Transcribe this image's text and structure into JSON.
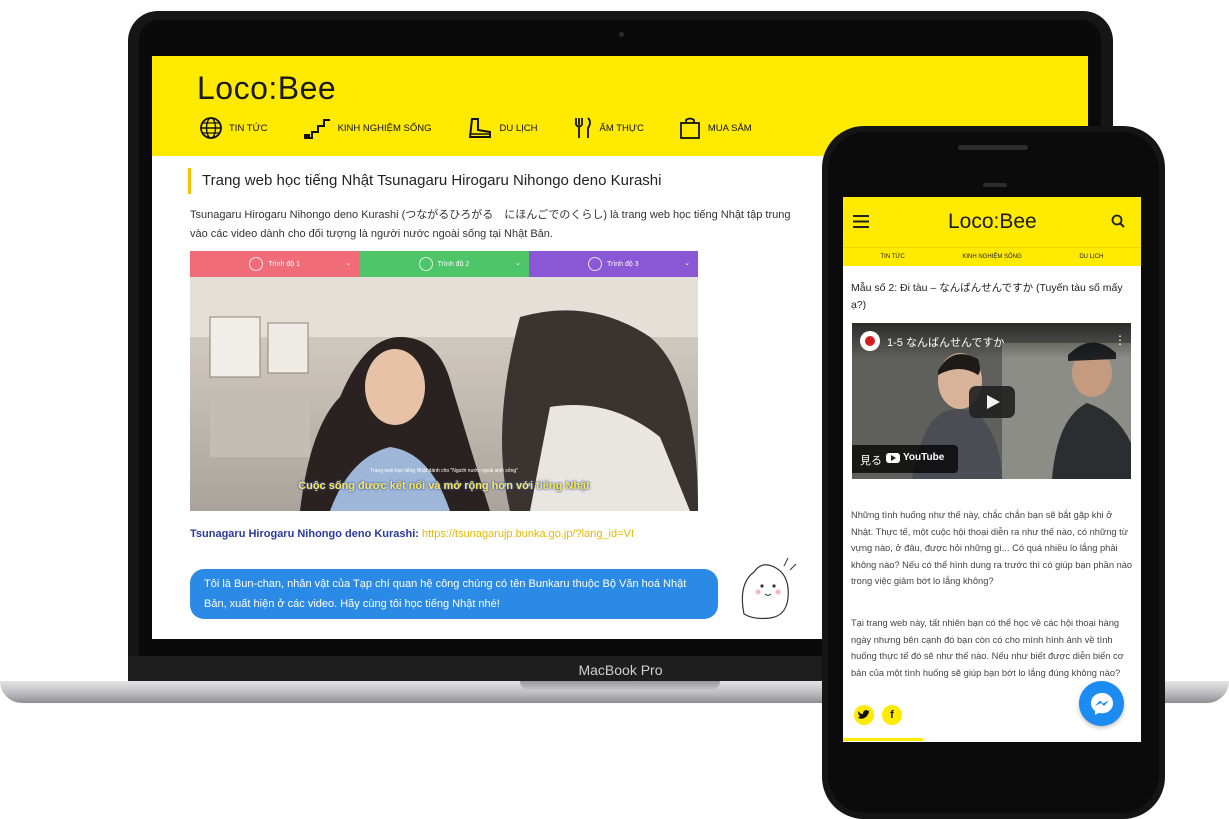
{
  "laptop": {
    "label": "MacBook Pro",
    "site": {
      "logo": "Loco:Bee",
      "nav": [
        {
          "label": "TIN TỨC",
          "icon": "globe-icon"
        },
        {
          "label": "KINH NGHIỆM SỐNG",
          "icon": "stairs-icon"
        },
        {
          "label": "DU LỊCH",
          "icon": "boot-icon"
        },
        {
          "label": "ẨM THỰC",
          "icon": "utensils-icon"
        },
        {
          "label": "MUA SẮM",
          "icon": "shopping-bag-icon"
        }
      ],
      "article_title": "Trang web học tiếng Nhật Tsunagaru Hirogaru Nihongo deno Kurashi",
      "article_intro": "Tsunagaru Hirogaru Nihongo deno Kurashi (つながるひろがる　にほんごでのくらし) là trang web học tiếng Nhật tập trung vào các video dành cho đối tượng là người nước ngoài sống tại Nhật Bản.",
      "video_tabs": [
        {
          "label": "Trình độ 1",
          "color": "#ef6c78"
        },
        {
          "label": "Trình độ 2",
          "color": "#4fc56a"
        },
        {
          "label": "Trình độ 3",
          "color": "#8a58d4"
        }
      ],
      "video_caption_small": "Trang web học tiếng Nhật dành cho \"Người nước ngoài sinh sống\"",
      "video_caption": "Cuộc sống được kết nối và mở rộng hơn với tiếng Nhật",
      "link_label": "Tsunagaru Hirogaru Nihongo deno Kurashi:",
      "link_url": "https://tsunagarujp.bunka.go.jp/?lang_id=VI",
      "bubble_text": "Tôi là Bun-chan, nhân vật của Tạp chí quan hệ công chúng có tên Bunkaru thuộc Bộ Văn hoá Nhật Bản, xuất hiện ở các video. Hãy cùng tôi học tiếng Nhật nhé!"
    }
  },
  "phone": {
    "logo": "Loco:Bee",
    "tabs": [
      "TIN TỨC",
      "KINH NGHIỆM SỐNG",
      "DU LỊCH"
    ],
    "article_title": "Mẫu số 2: Đi tàu – なんばんせんですか (Tuyến tàu số mấy ạ?)",
    "video": {
      "title": "1-5 なんばんせんですか",
      "watch_label": "見る",
      "brand": "YouTube"
    },
    "para1": "Những tình huống như thế này, chắc chắn bạn sẽ bắt gặp khi ở Nhật. Thực tế, một cuộc hội thoại diễn ra như thế nào, có những từ vựng nào, ở đâu, được hỏi những gì... Có quá nhiều lo lắng phải không nào? Nếu có thể hình dung ra trước thì có giúp bạn phần nào trong việc giảm bớt lo lắng không?",
    "para2": "Tại trang web này, tất nhiên bạn có thể học về các hội thoại hàng ngày nhưng bên cạnh đó bạn còn có cho mình hình ảnh về tình huống thực tế đó sẽ như thế nào. Nếu như biết được diễn biến cơ bản của một tình huống sẽ giúp bạn bớt lo lắng đúng không nào?",
    "social": [
      {
        "icon": "twitter-icon",
        "glyph": "t"
      },
      {
        "icon": "facebook-icon",
        "glyph": "f"
      }
    ]
  },
  "colors": {
    "brand_yellow": "#ffea00",
    "bubble_blue": "#2a8ae6",
    "messenger_blue": "#1d8cf2"
  }
}
